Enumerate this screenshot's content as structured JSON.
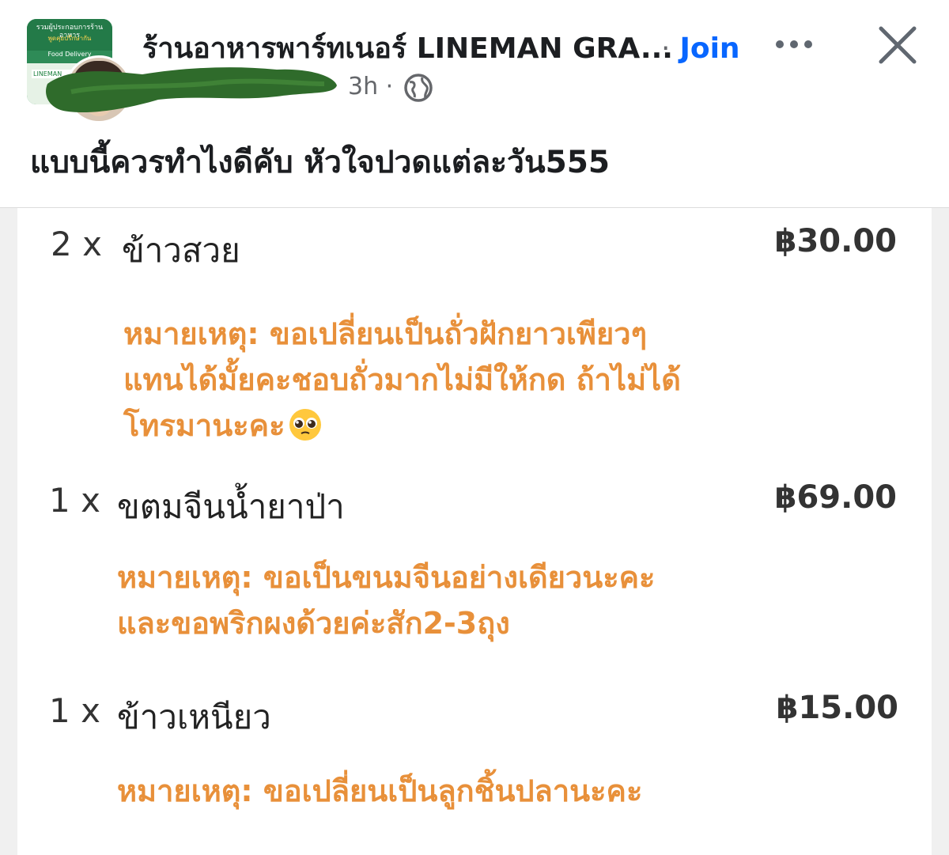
{
  "post": {
    "group_name": "ร้านอาหารพาร์ทเนอร์ LINEMAN GRA...",
    "join_separator": "·",
    "join_label": "Join",
    "time_ago": "3h ·",
    "text": "แบบนี้ควรทำไงดีคับ หัวใจปวดแต่ละวัน555",
    "thumb": {
      "line1": "รวมผู้ประกอบการร้านอาหาร",
      "line2": "พูดคุยปรึกษากัน",
      "line3": "Food Delivery",
      "badge": "LINEMAN"
    }
  },
  "order": {
    "items": [
      {
        "qty": "2 x",
        "name": "ข้าวสวย",
        "price": "฿30.00",
        "note": "หมายเหตุ: ขอเปลี่ยนเป็นถั่วฝักยาวเพียวๆ\nแทนได้มั้ยคะชอบถั่วมากไม่มีให้กด ถ้าไม่ได้\nโทรมานะคะ"
      },
      {
        "qty": "1 x",
        "name": "ขตมจีนน้ำยาป่า",
        "price": "฿69.00",
        "note": "หมายเหตุ: ขอเป็นขนมจีนอย่างเดียวนะคะ\nและขอพริกผงด้วยค่ะสัก2-3ถุง"
      },
      {
        "qty": "1 x",
        "name": "ข้าวเหนียว",
        "price": "฿15.00",
        "note": "หมายเหตุ: ขอเปลี่ยนเป็นลูกชิ้นปลานะคะ"
      }
    ]
  },
  "colors": {
    "join_link": "#0866ff",
    "note_text": "#e8903a",
    "redaction": "#2f6b2b"
  }
}
